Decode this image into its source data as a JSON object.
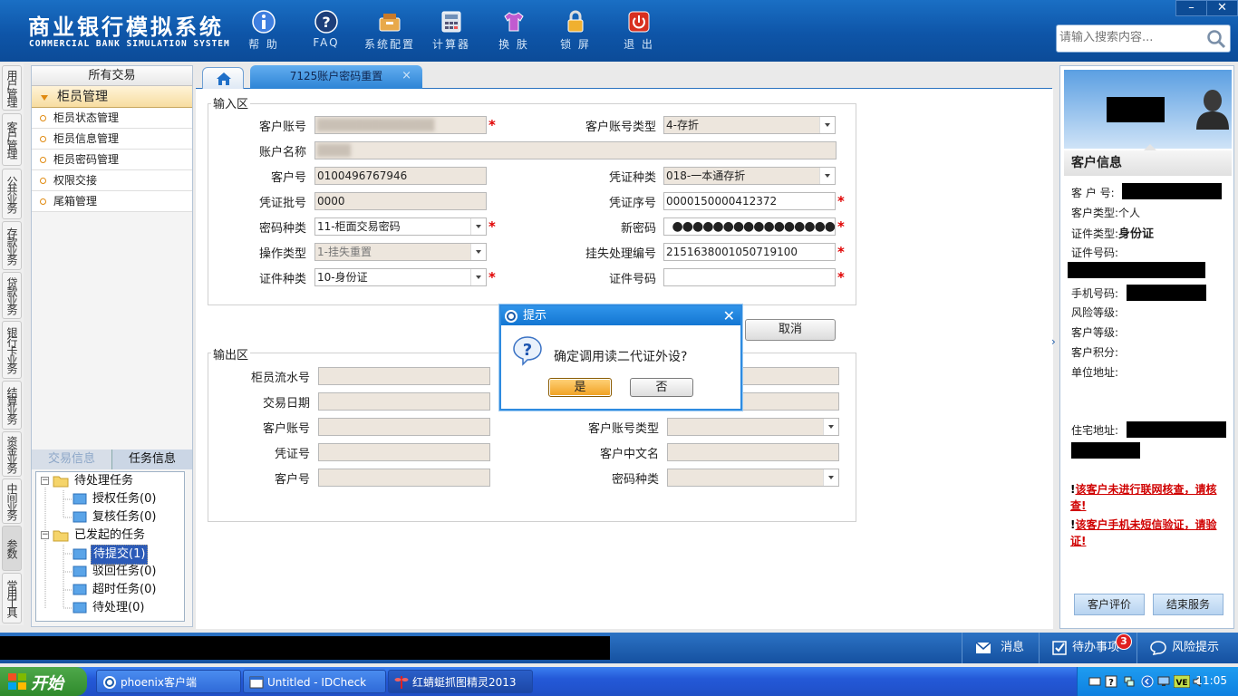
{
  "header": {
    "title_cn": "商业银行模拟系统",
    "title_en": "COMMERCIAL BANK SIMULATION SYSTEM",
    "toolbar": [
      {
        "label": "帮 助",
        "icon": "info-icon"
      },
      {
        "label": "FAQ",
        "icon": "question-icon"
      },
      {
        "label": "系统配置",
        "icon": "config-icon"
      },
      {
        "label": "计算器",
        "icon": "calculator-icon"
      },
      {
        "label": "换 肤",
        "icon": "shirt-icon"
      },
      {
        "label": "锁 屏",
        "icon": "lock-icon"
      },
      {
        "label": "退 出",
        "icon": "power-icon"
      }
    ],
    "window_min": "–",
    "window_close": "✕",
    "search_placeholder": "请输入搜索内容..."
  },
  "vnav": [
    "用户管理",
    "客户管理",
    "公共业务",
    "存款业务",
    "贷款业务",
    "银行卡业务",
    "结算业务",
    "资金业务",
    "中间业务",
    "参数",
    "常用工具"
  ],
  "left_panel": {
    "all_transactions": "所有交易",
    "category": "柜员管理",
    "menu": [
      "柜员状态管理",
      "柜员信息管理",
      "柜员密码管理",
      "权限交接",
      "尾箱管理"
    ],
    "tabs": {
      "tx_info": "交易信息",
      "task_info": "任务信息"
    },
    "tree": {
      "pending_group": "待处理任务",
      "pending": [
        "授权任务(0)",
        "复核任务(0)"
      ],
      "initiated_group": "已发起的任务",
      "initiated": [
        "待提交(1)",
        "驳回任务(0)",
        "超时任务(0)",
        "待处理(0)"
      ]
    }
  },
  "tabs": {
    "active": "7125账户密码重置",
    "close": "×"
  },
  "input_area": {
    "title": "输入区",
    "labels": {
      "account_no": "客户账号",
      "account_type": "客户账号类型",
      "account_name": "账户名称",
      "customer_no": "客户号",
      "voucher_type": "凭证种类",
      "voucher_batch": "凭证批号",
      "voucher_seq": "凭证序号",
      "pwd_type": "密码种类",
      "new_pwd": "新密码",
      "op_type": "操作类型",
      "loss_no": "挂失处理编号",
      "id_type": "证件种类",
      "id_no": "证件号码"
    },
    "values": {
      "account_type": "4-存折",
      "customer_no": "0100496767946",
      "voucher_type": "018-一本通存折",
      "voucher_batch": "0000",
      "voucher_seq": "0000150000412372",
      "pwd_type": "11-柜面交易密码",
      "new_pwd": "●●●●●●●●●●●●●●●●",
      "op_type": "1-挂失重置",
      "loss_no": "2151638001050719100",
      "id_type": "10-身份证",
      "id_no": ""
    },
    "required_mark": "*",
    "cancel": "取消"
  },
  "output_area": {
    "title": "输出区",
    "labels": {
      "teller_seq": "柜员流水号",
      "tx_date": "交易日期",
      "account_no": "客户账号",
      "account_type": "客户账号类型",
      "voucher_no": "凭证号",
      "cn_name": "客户中文名",
      "customer_no": "客户号",
      "pwd_type": "密码种类"
    }
  },
  "dialog": {
    "title": "提示",
    "message": "确定调用读二代证外设?",
    "yes": "是",
    "no": "否",
    "close": "✕"
  },
  "right_panel": {
    "header": "客户信息",
    "fields": {
      "customer_no": "客 户 号:",
      "customer_type": "客户类型:",
      "customer_type_val": "个人",
      "id_type": "证件类型:",
      "id_type_val": "身份证",
      "id_no": "证件号码:",
      "phone": "手机号码:",
      "risk": "风险等级:",
      "level": "客户等级:",
      "points": "客户积分:",
      "work_addr": "单位地址:",
      "home_addr": "住宅地址:"
    },
    "warnings": [
      "该客户未进行联网核查，请核查!",
      "该客户手机未短信验证，请验证!"
    ],
    "warn_mark": "!",
    "buttons": {
      "evaluate": "客户评价",
      "end": "结束服务"
    }
  },
  "bottom_bar": {
    "message": "消息",
    "todo": "待办事项",
    "todo_count": "3",
    "risk": "风险提示"
  },
  "taskbar": {
    "start": "开始",
    "items": [
      "phoenix客户端",
      "Untitled - IDCheck",
      "红蜻蜓抓图精灵2013"
    ],
    "clock": "11:05"
  }
}
